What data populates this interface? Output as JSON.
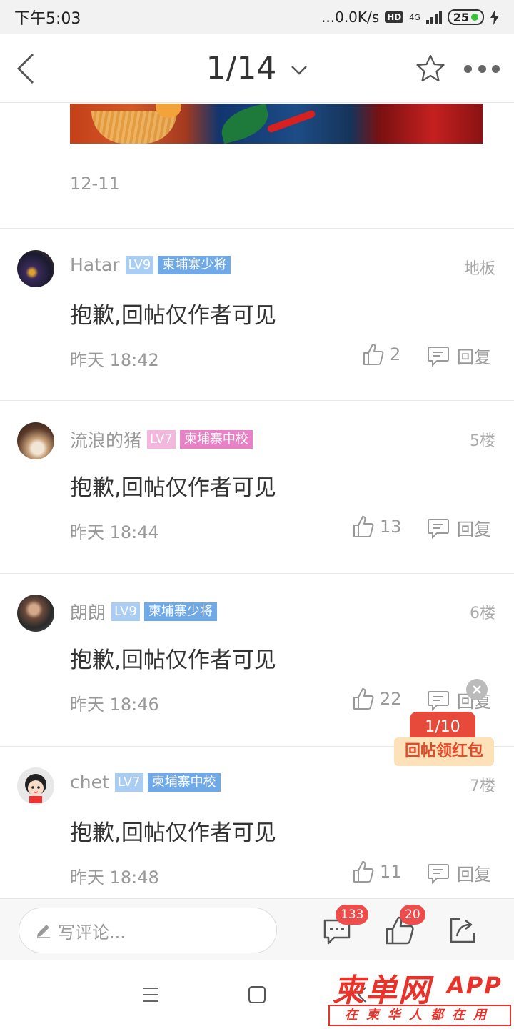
{
  "status_bar": {
    "time": "下午5:03",
    "net_speed": "...0.0K/s",
    "hd": "HD",
    "network": "4G",
    "battery": "25"
  },
  "nav": {
    "page_indicator": "1/14"
  },
  "post": {
    "date": "12-11"
  },
  "comments": [
    {
      "user": "Hatar",
      "level": "LV9",
      "rank": "柬埔寨少将",
      "floor": "地板",
      "text": "抱歉,回帖仅作者可见",
      "time": "昨天 18:42",
      "likes": "2",
      "reply_label": "回复"
    },
    {
      "user": "流浪的猪",
      "level": "LV7",
      "rank": "柬埔寨中校",
      "floor": "5楼",
      "text": "抱歉,回帖仅作者可见",
      "time": "昨天 18:44",
      "likes": "13",
      "reply_label": "回复"
    },
    {
      "user": "朗朗",
      "level": "LV9",
      "rank": "柬埔寨少将",
      "floor": "6楼",
      "text": "抱歉,回帖仅作者可见",
      "time": "昨天 18:46",
      "likes": "22",
      "reply_label": "回复"
    },
    {
      "user": "chet",
      "level": "LV7",
      "rank": "柬埔寨中校",
      "floor": "7楼",
      "text": "抱歉,回帖仅作者可见",
      "time": "昨天 18:48",
      "likes": "11",
      "reply_label": "回复"
    }
  ],
  "red_packet": {
    "progress": "1/10",
    "label": "回帖领红包"
  },
  "bottom_bar": {
    "comment_placeholder": "写评论...",
    "comment_count": "133",
    "like_count": "20"
  },
  "watermark": {
    "brand": "柬单网",
    "app": "APP",
    "slogan": "在柬华人都在用"
  },
  "colors": {
    "accent_red": "#e8322a",
    "blue_rank": "#6fa9e8",
    "pink_rank": "#e882c6",
    "badge_red": "#f04b4b"
  }
}
